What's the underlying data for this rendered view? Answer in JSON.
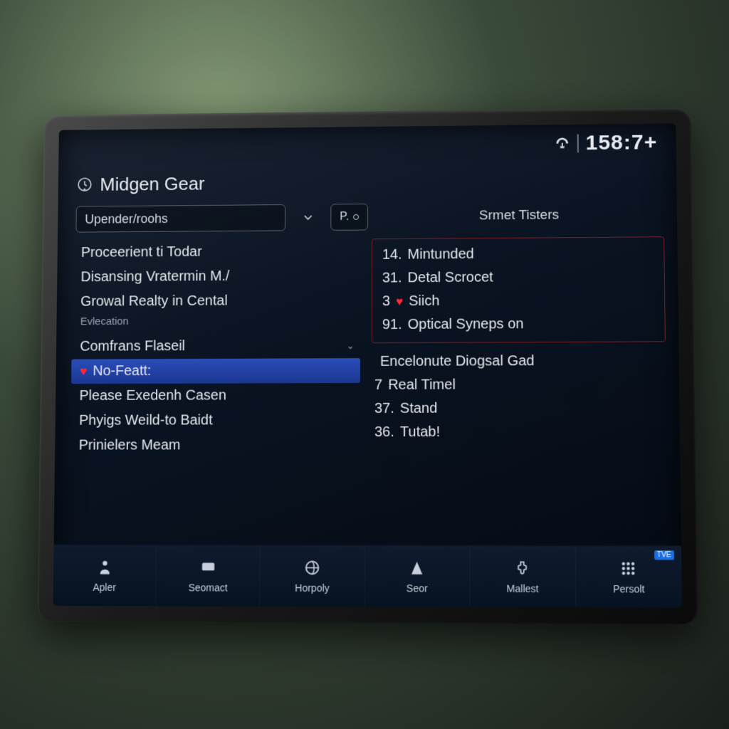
{
  "status": {
    "clock": "158:7+"
  },
  "header": {
    "title": "Midgen Gear"
  },
  "controls": {
    "dropdown_label": "Upender/roohs",
    "pill_label": "P.",
    "right_tab_label": "Srmet Tisters"
  },
  "left_list": [
    {
      "label": "Proceerient ti Todar"
    },
    {
      "label": "Disansing Vratermin M./"
    },
    {
      "label": "Growal Realty in Cental"
    },
    {
      "label": "Evlecation",
      "small": true
    },
    {
      "label": "Comfrans Flaseil",
      "caret": true
    },
    {
      "label": "No-Featt:",
      "selected": true,
      "heart": true
    },
    {
      "label": "Please Exedenh Casen"
    },
    {
      "label": "Phyigs Weild-to Baidt"
    },
    {
      "label": "Prinielers Meam"
    }
  ],
  "right_group_top": [
    {
      "num": "14.",
      "label": "Mintunded"
    },
    {
      "num": "31.",
      "label": "Detal Scrocet"
    },
    {
      "num": "3",
      "label": "Siich",
      "heart": true
    },
    {
      "num": "91.",
      "label": "Optical Syneps on"
    }
  ],
  "right_group_bottom": [
    {
      "num": "",
      "label": "Encelonute Diogsal Gad"
    },
    {
      "num": "7",
      "label": "Real Timel"
    },
    {
      "num": "37.",
      "label": "Stand"
    },
    {
      "num": "36.",
      "label": "Tutab!"
    }
  ],
  "nav": [
    {
      "label": "Apler"
    },
    {
      "label": "Seomact"
    },
    {
      "label": "Horpoly"
    },
    {
      "label": "Seor"
    },
    {
      "label": "Mallest"
    },
    {
      "label": "Persolt",
      "badge": "TVE"
    }
  ]
}
